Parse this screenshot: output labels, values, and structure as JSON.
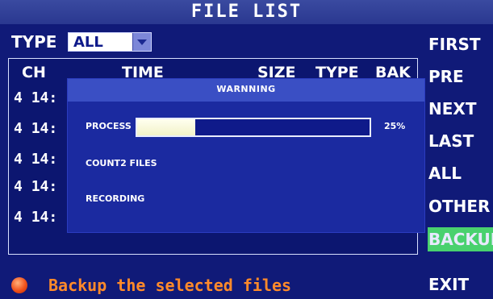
{
  "header": {
    "title": "FILE LIST"
  },
  "filter": {
    "label": "TYPE",
    "value": "ALL"
  },
  "table": {
    "headers": [
      "CH",
      "TIME",
      "SIZE",
      "TYPE",
      "BAK"
    ],
    "rows": [
      {
        "ch": "4",
        "time": "14:"
      },
      {
        "ch": "4",
        "time": "14:"
      },
      {
        "ch": "4",
        "time": "14:"
      },
      {
        "ch": "4",
        "time": "14:"
      },
      {
        "ch": "4",
        "time": "14:"
      }
    ]
  },
  "dialog": {
    "title": "WARNNING",
    "process_label": "PROCESS",
    "progress_percent_text": "25%",
    "progress_fraction": 0.25,
    "count_text": "COUNT2 FILES",
    "status_text": "RECORDING"
  },
  "sidebar": {
    "buttons": [
      "FIRST",
      "PRE",
      "NEXT",
      "LAST",
      "ALL",
      "OTHER",
      "BACKUP",
      "EXIT"
    ],
    "active": "BACKUP"
  },
  "status_bar": {
    "message": "Backup the selected files"
  },
  "colors": {
    "accent_green": "#49d16e",
    "background_blue": "#101a78",
    "status_orange": "#ff8a2a"
  }
}
